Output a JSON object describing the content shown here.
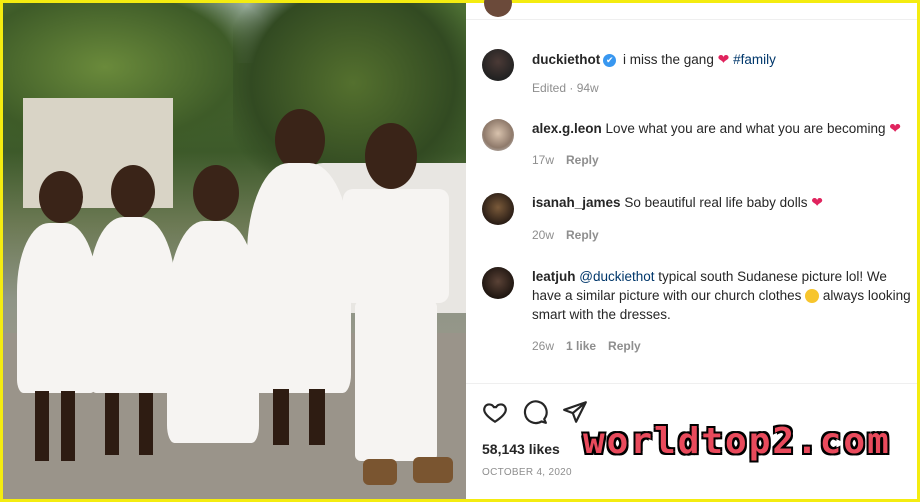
{
  "post": {
    "owner": "duckiethot",
    "caption_text": "i miss the gang",
    "caption_tag": "#family",
    "caption_meta": "Edited · 94w",
    "likes": "58,143 likes",
    "date": "OCTOBER 4, 2020"
  },
  "comments": [
    {
      "user": "alex.g.leon",
      "text": "Love what you are and what you are becoming",
      "time": "17w",
      "reply": "Reply",
      "likes": ""
    },
    {
      "user": "isanah_james",
      "text": "So beautiful real life baby dolls",
      "time": "20w",
      "reply": "Reply",
      "likes": ""
    },
    {
      "user": "leatjuh",
      "mention": "@duckiethot",
      "text": " typical south Sudanese picture lol! We have a similar picture with our church clothes",
      "text2": " always looking smart with the dresses.",
      "time": "26w",
      "likes": "1 like",
      "reply": "Reply"
    }
  ],
  "watermark": "worldtop2.com",
  "icons": [
    "heart-outline-icon",
    "comment-icon",
    "share-icon",
    "verified-icon",
    "red-heart-emoji",
    "laughing-emoji"
  ],
  "colors": {
    "frame": "#f4ec10",
    "verified": "#3897f0",
    "tag": "#00376b",
    "watermark": "#e94a5c",
    "heart": "#e0245e"
  }
}
